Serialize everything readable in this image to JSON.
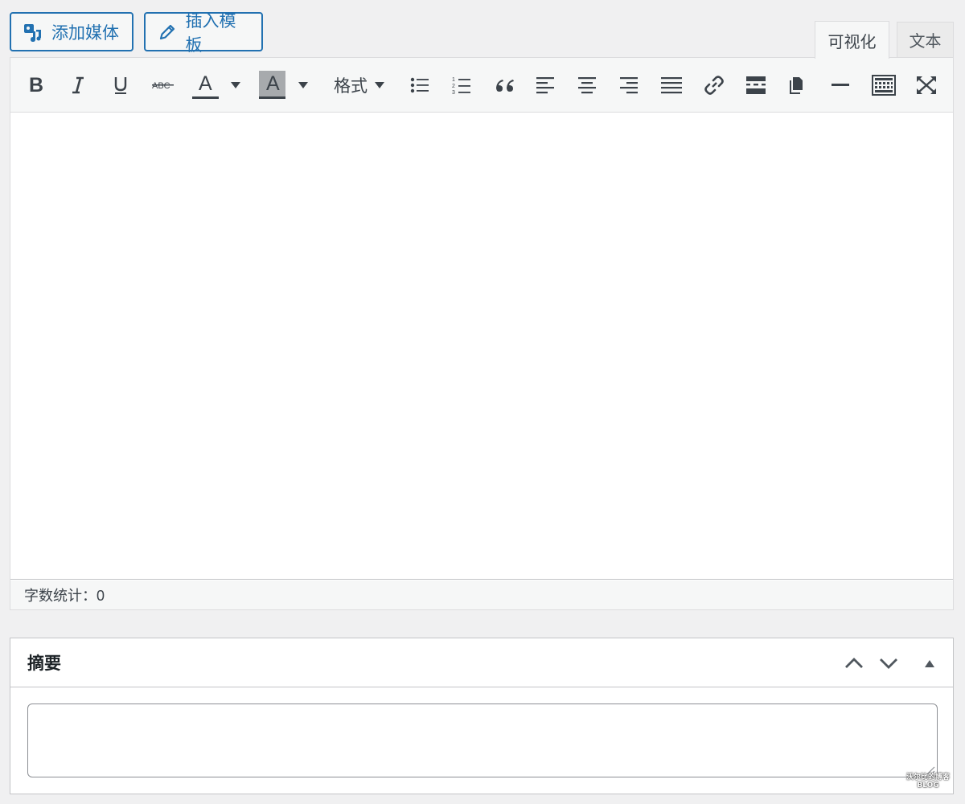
{
  "media_buttons": {
    "add_media": {
      "label": "添加媒体",
      "icon": "add-media-icon"
    },
    "insert_template": {
      "label": "插入模板",
      "icon": "pencil-icon"
    }
  },
  "editor_tabs": [
    {
      "label": "可视化",
      "active": true
    },
    {
      "label": "文本",
      "active": false
    }
  ],
  "toolbar": {
    "format_label": "格式",
    "text_color_glyph": "A",
    "bg_color_glyph": "A",
    "buttons": [
      "bold-icon",
      "italic-icon",
      "underline-icon",
      "strikethrough-icon",
      "text-color-icon",
      "background-color-icon",
      "format-select",
      "bullet-list-icon",
      "numbered-list-icon",
      "blockquote-icon",
      "align-left-icon",
      "align-center-icon",
      "align-right-icon",
      "justify-icon",
      "link-icon",
      "read-more-icon",
      "paste-icon",
      "horizontal-rule-icon",
      "toolbar-toggle-icon",
      "fullscreen-icon"
    ]
  },
  "status_bar": {
    "word_count_text": "字数统计：0"
  },
  "excerpt": {
    "title": "摘要",
    "value": ""
  },
  "watermark": {
    "line1": "沃尔比的博客",
    "line2": "BLOG"
  },
  "colors": {
    "accent": "#2271b1",
    "page_bg": "#f0f0f1",
    "toolbar_bg": "#f6f7f7",
    "border": "#dcdcde",
    "icon": "#3c434a"
  }
}
